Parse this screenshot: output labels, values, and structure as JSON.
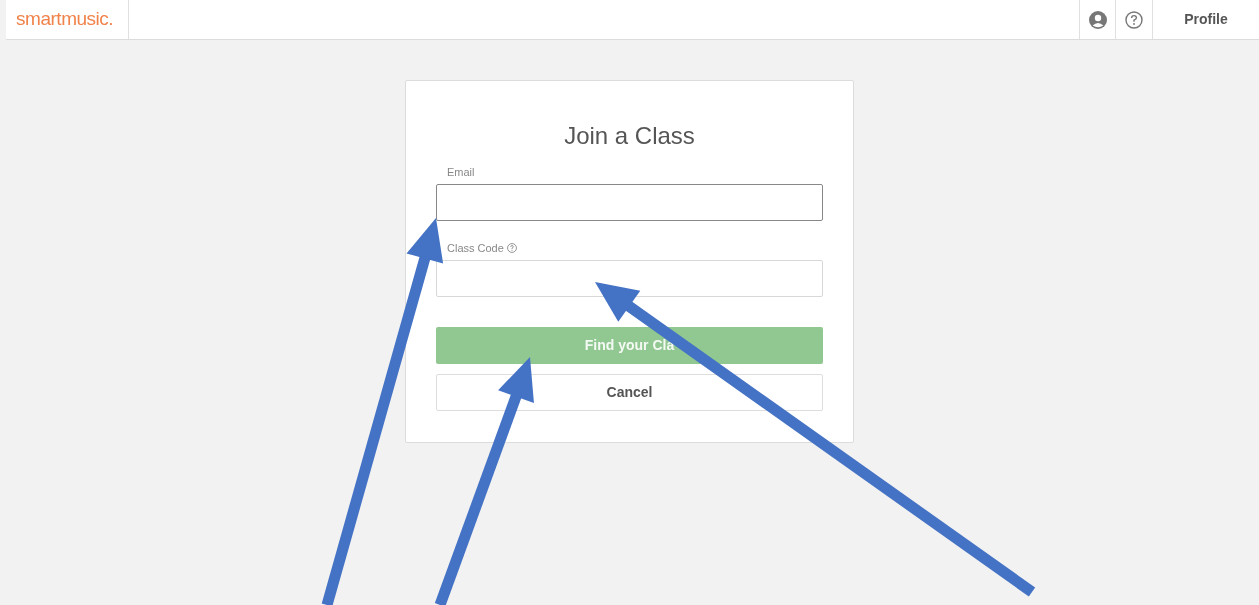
{
  "header": {
    "logo": "smartmusic.",
    "profile_link": "Profile"
  },
  "dialog": {
    "title": "Join a Class",
    "fields": [
      {
        "label": "Email",
        "focused": true,
        "help": false
      },
      {
        "label": "Class Code",
        "focused": false,
        "help": true
      }
    ],
    "buttons": [
      {
        "label": "Find your Cla",
        "kind": "primary",
        "disabled": true
      },
      {
        "label": "Cancel",
        "kind": "secondary",
        "disabled": false
      }
    ]
  },
  "annotations": [
    {
      "kind": "arrow",
      "color": "#4472c4"
    },
    {
      "kind": "arrow",
      "color": "#4472c4"
    },
    {
      "kind": "arrow",
      "color": "#4472c4"
    }
  ]
}
